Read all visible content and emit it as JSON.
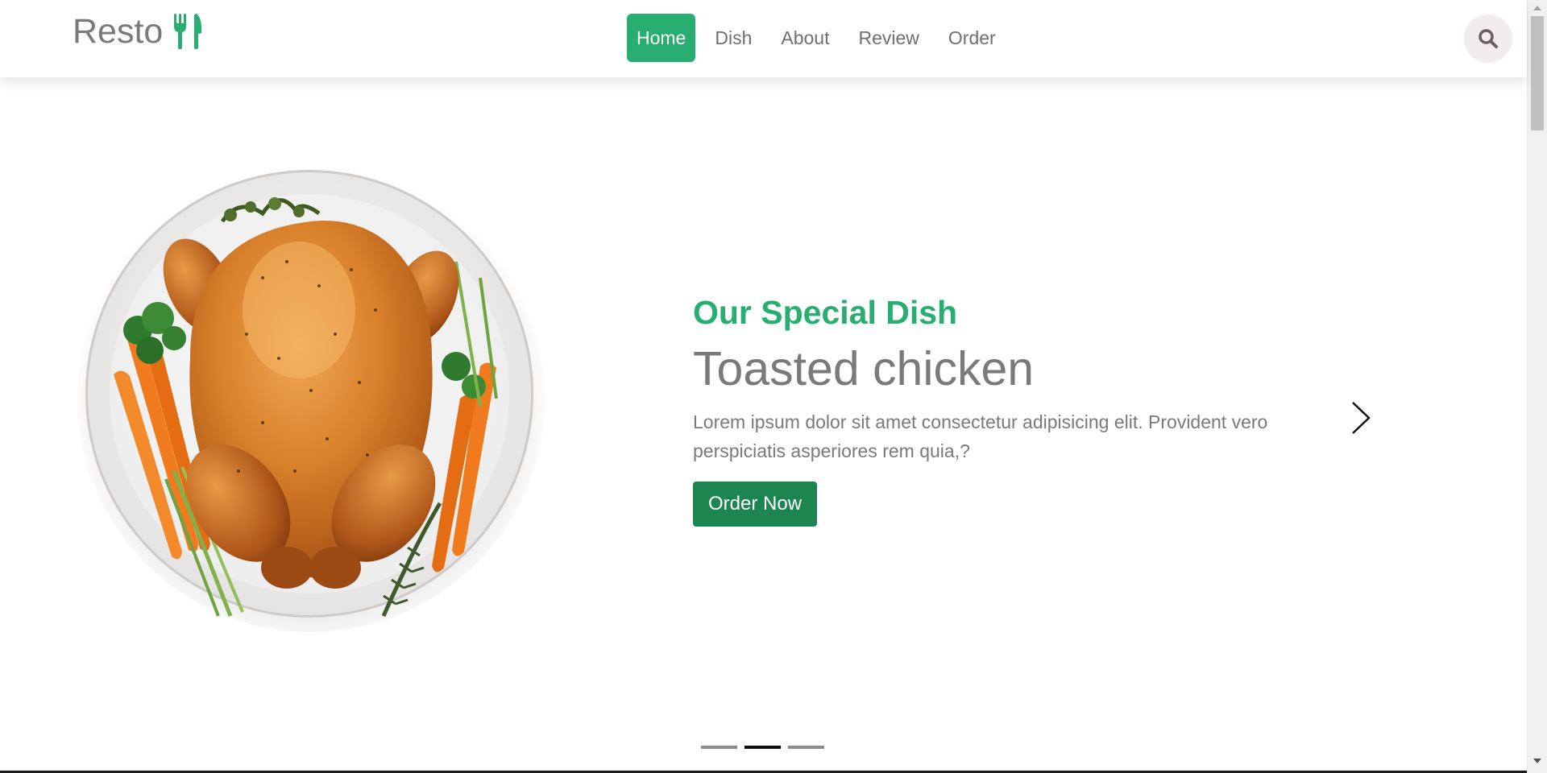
{
  "header": {
    "logo_text": "Resto",
    "logo_icon": "utensils-icon",
    "nav": [
      {
        "label": "Home",
        "active": true
      },
      {
        "label": "Dish",
        "active": false
      },
      {
        "label": "About",
        "active": false
      },
      {
        "label": "Review",
        "active": false
      },
      {
        "label": "Order",
        "active": false
      }
    ],
    "search_icon": "search-icon"
  },
  "hero": {
    "image_alt": "roasted chicken on a plate",
    "subtitle": "Our Special Dish",
    "title": "Toasted chicken",
    "description": "Lorem ipsum dolor sit amet consectetur adipisicing elit. Provident vero perspiciatis asperiores rem quia,?",
    "button_label": "Order Now",
    "next_icon": "chevron-right-icon",
    "pagination": {
      "total": 3,
      "active_index": 1
    }
  },
  "colors": {
    "accent": "#27ae70",
    "button": "#1c8550",
    "text_gray": "#7a7a7a"
  }
}
